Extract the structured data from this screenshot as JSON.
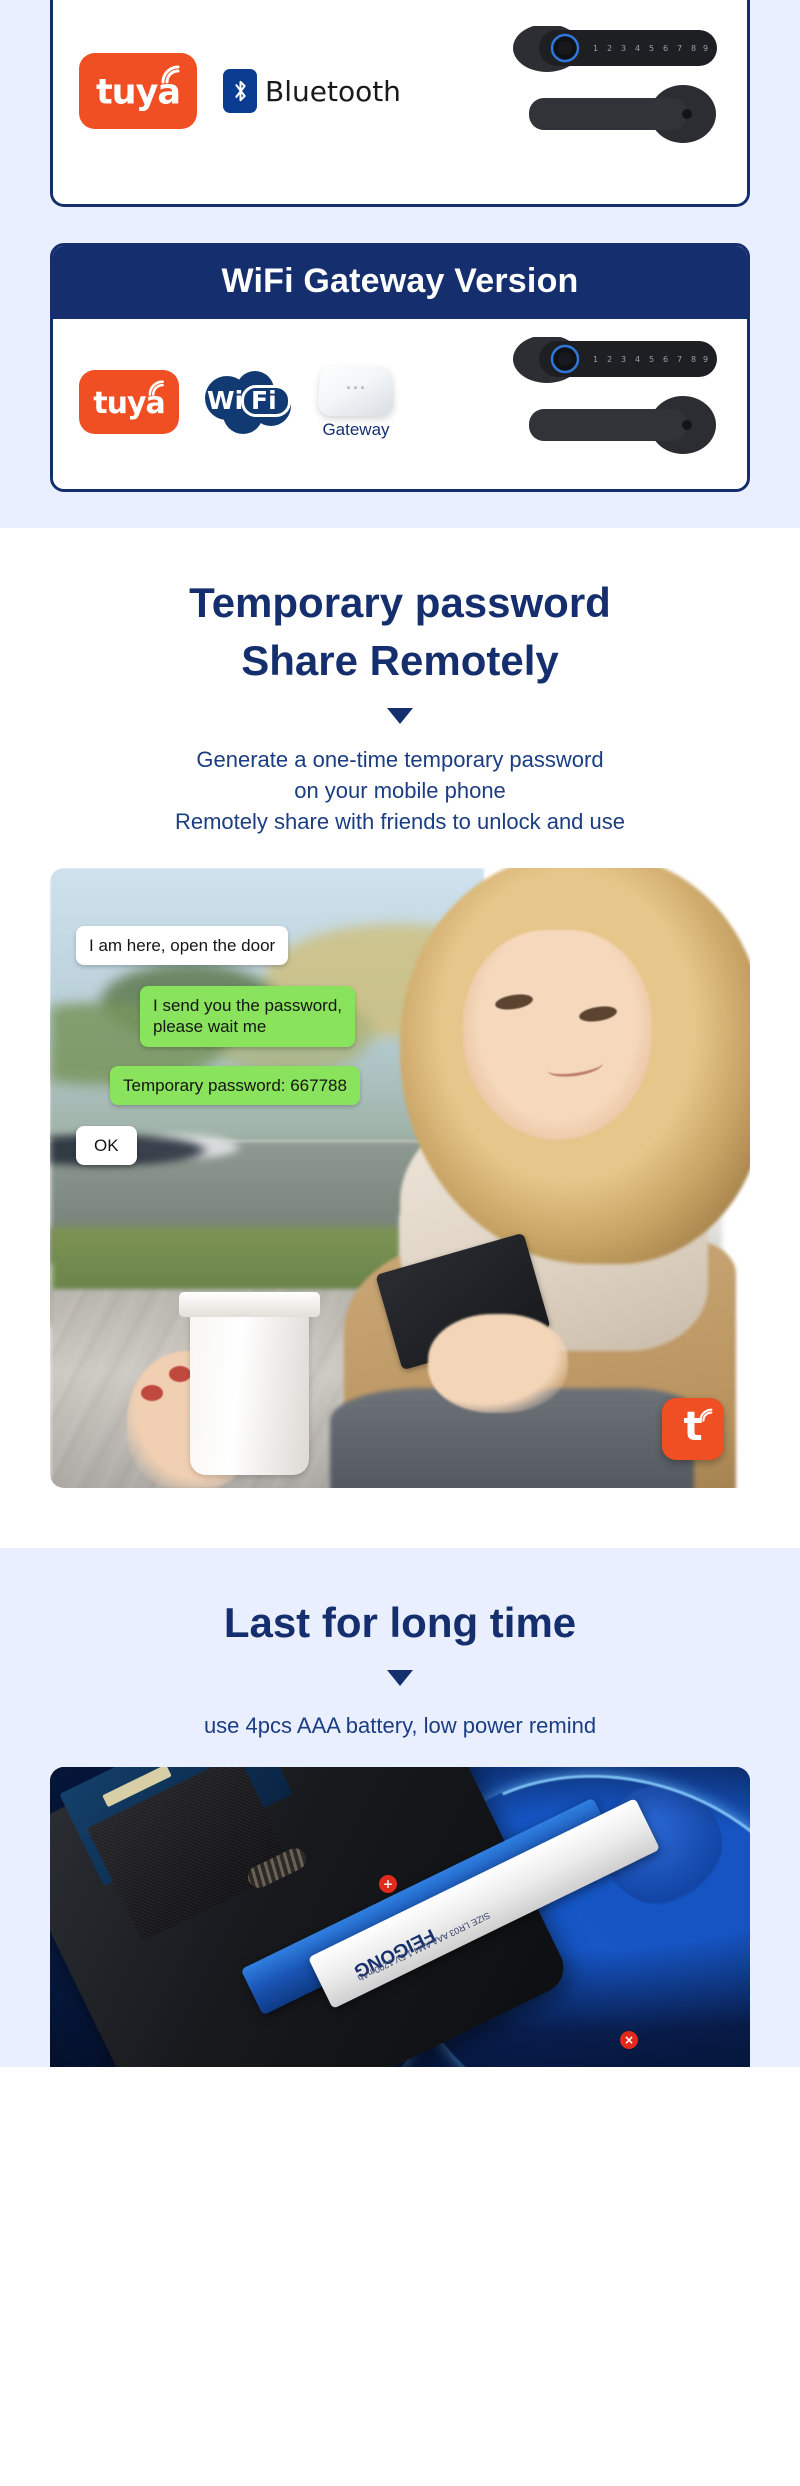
{
  "bluetooth_card": {
    "brand_logo": "tuya-logo",
    "brand_text": "tuya",
    "connectivity_icon": "bluetooth-icon",
    "connectivity_label": "Bluetooth",
    "product_image": "smart-door-lock-image"
  },
  "wifi_card": {
    "header_title": "WiFi Gateway Version",
    "brand_logo": "tuya-logo",
    "brand_text": "tuya",
    "connectivity_icon": "wifi-cloud-icon",
    "connectivity_label": "Wi Fi",
    "gateway_label": "Gateway",
    "gateway_icon": "gateway-device-icon",
    "product_image": "smart-door-lock-image"
  },
  "temporary_password_section": {
    "title_line_1": "Temporary password",
    "title_line_2": "Share Remotely",
    "divider_icon": "triangle-down-icon",
    "subtitle_line_1": "Generate a one-time temporary password",
    "subtitle_line_2": "on your mobile phone",
    "subtitle_line_3": "Remotely share with friends to unlock and use",
    "photo": {
      "alt": "woman-using-phone-photo",
      "chat": [
        {
          "text": "I am here, open the door",
          "type": "incoming"
        },
        {
          "text": "I send you the password,\nplease wait me",
          "type": "outgoing"
        },
        {
          "text": "Temporary password: 667788",
          "type": "outgoing"
        },
        {
          "text": "OK",
          "type": "incoming"
        }
      ],
      "badge": "tuya-app-badge",
      "badge_glyph": "t"
    }
  },
  "battery_section": {
    "title": "Last for long time",
    "divider_icon": "triangle-down-icon",
    "subtitle": "use 4pcs AAA battery, low power remind",
    "photo": {
      "alt": "battery-compartment-photo",
      "battery_brand": "FEIGONG",
      "battery_spec": "SIZE LR03 AAA AM4 1.5V   1200mAh",
      "polarity_positive": "+",
      "polarity_negative": "×"
    }
  },
  "colors": {
    "brand_navy": "#152f6e",
    "brand_orange": "#f04e23",
    "bluetooth_blue": "#0a3d91",
    "band_bg": "#eaefff",
    "chat_green": "#8ae35c"
  }
}
